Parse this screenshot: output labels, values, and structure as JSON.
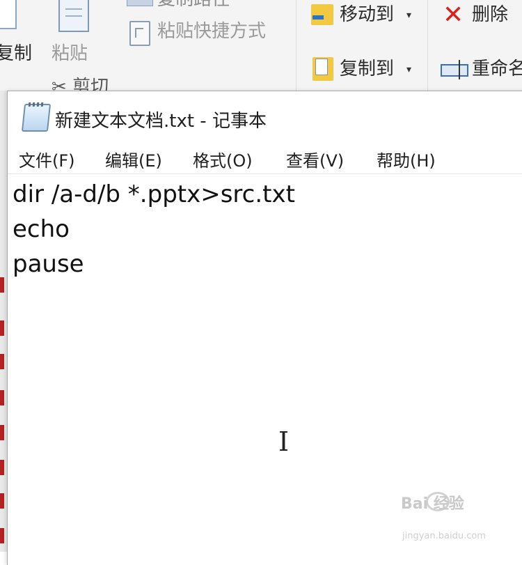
{
  "ribbon": {
    "copy_label": "复制",
    "paste_label": "粘贴",
    "copy_path_label": "复制路径",
    "paste_shortcut_label": "粘贴快捷方式",
    "cut_label": "剪切",
    "move_to_label": "移动到",
    "copy_to_label": "复制到",
    "delete_label": "删除",
    "rename_label": "重命名",
    "dropdown_glyph": "▾"
  },
  "notepad": {
    "title": "新建文本文档.txt - 记事本",
    "menu": [
      "文件(F)",
      "编辑(E)",
      "格式(O)",
      "查看(V)",
      "帮助(H)"
    ],
    "lines": [
      "dir /a-d/b *.pptx>src.txt",
      "echo",
      "pause"
    ],
    "cursor_glyph": "I"
  },
  "watermark": {
    "brand": "Bai 经验",
    "url": "jingyan.baidu.com"
  }
}
